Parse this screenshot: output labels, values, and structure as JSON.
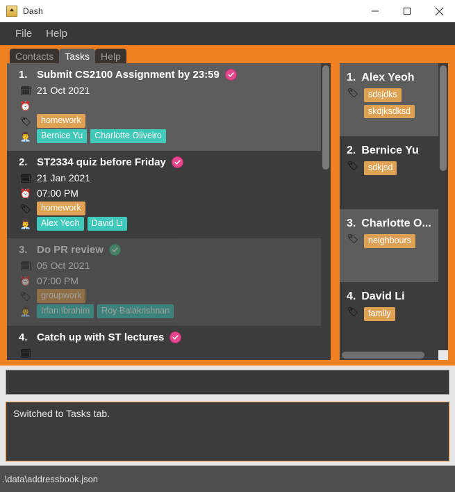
{
  "window": {
    "title": "Dash",
    "app_icon": "app-icon",
    "minimize_label": "Minimize",
    "maximize_label": "Maximize",
    "close_label": "Close"
  },
  "menubar": {
    "items": [
      {
        "label": "File"
      },
      {
        "label": "Help"
      }
    ]
  },
  "tabs": [
    {
      "label": "Contacts",
      "active": false
    },
    {
      "label": "Tasks",
      "active": true
    },
    {
      "label": "Help",
      "active": false
    }
  ],
  "icons": {
    "calendar": "🗓",
    "clock": "⏰",
    "tag": "🏷",
    "person": "👨‍💼"
  },
  "task_panel": {
    "tasks": [
      {
        "index": "1.",
        "name": "Submit CS2100 Assignment by 23:59",
        "status": "pink",
        "date": "21 Oct 2021",
        "time": "",
        "tags": [
          "homework"
        ],
        "people": [
          "Bernice Yu",
          "Charlotte Oliveiro"
        ],
        "completed": false
      },
      {
        "index": "2.",
        "name": "ST2334 quiz before Friday",
        "status": "pink",
        "date": "21 Jan 2021",
        "time": "07:00 PM",
        "tags": [
          "homework"
        ],
        "people": [
          "Alex Yeoh",
          "David Li"
        ],
        "completed": false
      },
      {
        "index": "3.",
        "name": "Do PR review",
        "status": "green",
        "date": "05 Oct 2021",
        "time": "07:00 PM",
        "tags": [
          "groupwork"
        ],
        "people": [
          "Irfan Ibrahim",
          "Roy Balakrishnan"
        ],
        "completed": true
      },
      {
        "index": "4.",
        "name": "Catch up with ST lectures",
        "status": "pink",
        "date": "",
        "time": "",
        "tags": [],
        "people": [],
        "completed": false
      }
    ]
  },
  "person_panel": {
    "persons": [
      {
        "index": "1.",
        "name": "Alex Yeoh",
        "tags": [
          "sdsjdks",
          "skdjksdksd"
        ]
      },
      {
        "index": "2.",
        "name": "Bernice Yu",
        "tags": [
          "sdkjsd"
        ]
      },
      {
        "index": "3.",
        "name": "Charlotte O...",
        "tags": [
          "neighbours"
        ]
      },
      {
        "index": "4.",
        "name": "David Li",
        "tags": [
          "family"
        ]
      }
    ]
  },
  "command": {
    "value": "",
    "placeholder": ""
  },
  "result": {
    "text": "Switched to Tasks tab."
  },
  "status": {
    "text": ".\\data\\addressbook.json"
  },
  "colors": {
    "accent_orange": "#ef8122",
    "panel_dark": "#3c3c3c",
    "panel_light": "#5d5d5d",
    "tag_chip": "#dfa153",
    "person_chip": "#3ec9bb",
    "badge_pink": "#e8478f",
    "badge_green": "#53c793",
    "status_bar": "#4e4e4e"
  }
}
